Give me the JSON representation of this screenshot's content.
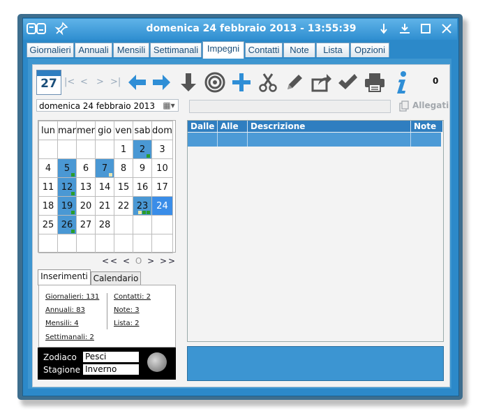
{
  "window": {
    "title": "domenica 24 febbraio 2013 - 13:55:39"
  },
  "tabs": [
    "Giornalieri",
    "Annuali",
    "Mensili",
    "Settimanali",
    "Impegni",
    "Contatti",
    "Note",
    "Lista",
    "Opzioni"
  ],
  "active_tab": "Impegni",
  "toolbar": {
    "calendar_icon_day": "27",
    "count": "0",
    "icons": [
      "first-icon",
      "prev-icon",
      "next-icon",
      "last-icon",
      "arrow-left-icon",
      "arrow-right-icon",
      "arrow-down-icon",
      "target-icon",
      "plus-icon",
      "scissors-icon",
      "pencil-icon",
      "share-icon",
      "check-icon",
      "printer-icon",
      "info-icon"
    ]
  },
  "date_select": {
    "value": "domenica 24  febbraio  2013"
  },
  "attachments": {
    "label": "Allegati"
  },
  "calendar": {
    "weekdays": [
      "lun",
      "mar",
      "mer",
      "gio",
      "ven",
      "sab",
      "dom"
    ],
    "weeks": [
      [
        "",
        "",
        "",
        "",
        "1",
        "2",
        "3"
      ],
      [
        "4",
        "5",
        "6",
        "7",
        "8",
        "9",
        "10"
      ],
      [
        "11",
        "12",
        "13",
        "14",
        "15",
        "16",
        "17"
      ],
      [
        "18",
        "19",
        "20",
        "21",
        "22",
        "23",
        "24"
      ],
      [
        "25",
        "26",
        "27",
        "28",
        "",
        "",
        ""
      ],
      [
        "",
        "",
        "",
        "",
        "",
        "",
        ""
      ]
    ],
    "highlighted_days": [
      "2",
      "5",
      "7",
      "12",
      "19",
      "23",
      "26"
    ],
    "today": "24",
    "nav": [
      "<<",
      "<",
      "O",
      ">",
      ">>"
    ]
  },
  "inner_tabs": [
    "Inserimenti",
    "Calendario"
  ],
  "inserimenti": {
    "left": [
      "Giornalieri: 131",
      "Annuali: 83",
      "Mensili: 4",
      "Settimanali: 2"
    ],
    "right": [
      "Contatti: 2",
      "Note: 3",
      "Lista: 2"
    ]
  },
  "zodiac": {
    "zodiac_label": "Zodiaco",
    "zodiac_value": "Pesci",
    "season_label": "Stagione",
    "season_value": "Inverno"
  },
  "appointments": {
    "columns": [
      "Dalle",
      "Alle",
      "Descrizione",
      "Note"
    ],
    "rows": []
  },
  "colors": {
    "accent": "#2c89c9",
    "selected_day": "#3a8de8",
    "highlight_day": "#4a98d4"
  }
}
